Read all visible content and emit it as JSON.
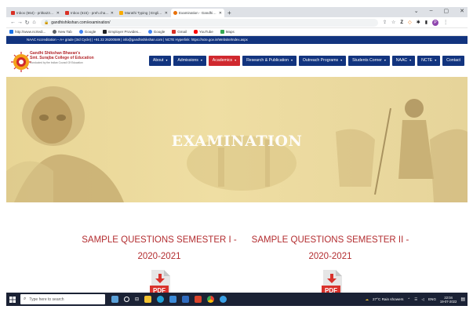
{
  "browser": {
    "tabs": [
      {
        "title": "Inbox (664) - pritka23@gmail.c",
        "favicon_color": "#d93025",
        "active": false
      },
      {
        "title": "Inbox (615) - preh.chandwani@g",
        "favicon_color": "#d93025",
        "active": false
      },
      {
        "title": "Marathi Typing | English to Mar",
        "favicon_color": "#f9ab00",
        "active": false
      },
      {
        "title": "Examination - Gandhi Shikshan",
        "favicon_color": "#e8710a",
        "active": true
      }
    ],
    "new_tab": "+",
    "window_controls": [
      "⌄",
      "–",
      "▢",
      "✕"
    ],
    "url": "gandhishikshan.com/examination/",
    "bookmarks": [
      {
        "label": "http://www.ncrtedi...",
        "color": "#1a73e8"
      },
      {
        "label": "New Tab",
        "color": "#5f6368"
      },
      {
        "label": "Google",
        "color": "#4285f4"
      },
      {
        "label": "Employer Provides...",
        "color": "#202124"
      },
      {
        "label": "Google",
        "color": "#4285f4"
      },
      {
        "label": "Gmail",
        "color": "#d93025"
      },
      {
        "label": "YouTube",
        "color": "#ff0000"
      },
      {
        "label": "Maps",
        "color": "#34a853"
      }
    ]
  },
  "site": {
    "naac_text": "NAAC Accreditation – A+ grade (3rd Cycle) | +91 22 26200589 | info@gandhishikshan.com | NCTE Hyperlink: https://ncte.gov.in/Website/Index.aspx",
    "logo_line1": "Gandhi Shikshan Bhavan's",
    "logo_line2": "Smt. Surajba College of Education",
    "logo_line3": "Conducted by the Indian Council Of Education",
    "menu": [
      {
        "label": "About",
        "caret": true,
        "active": false
      },
      {
        "label": "Admissions",
        "caret": true,
        "active": false
      },
      {
        "label": "Academics",
        "caret": true,
        "active": true
      },
      {
        "label": "Research & Publication",
        "caret": true,
        "active": false
      },
      {
        "label": "Outreach Programs",
        "caret": true,
        "active": false
      },
      {
        "label": "Students Corner",
        "caret": true,
        "active": false
      },
      {
        "label": "NAAC",
        "caret": true,
        "active": false
      },
      {
        "label": "NCTE",
        "caret": true,
        "active": false
      },
      {
        "label": "Contact",
        "caret": false,
        "active": false
      }
    ],
    "colors": {
      "navy": "#12347f",
      "accent_red": "#d0282e",
      "heading_red": "#b32d30"
    },
    "hero_title": "EXAMINATION",
    "q1": "SAMPLE QUESTIONS SEMESTER I - 2020-2021",
    "q2": "SAMPLE QUESTIONS SEMESTER II - 2020-2021",
    "pdf_label": "PDF"
  },
  "taskbar": {
    "search_placeholder": "Type here to search",
    "weather": "27°C Rain showers",
    "lang": "ENG",
    "time": "22:04",
    "date": "19-07-2022"
  }
}
